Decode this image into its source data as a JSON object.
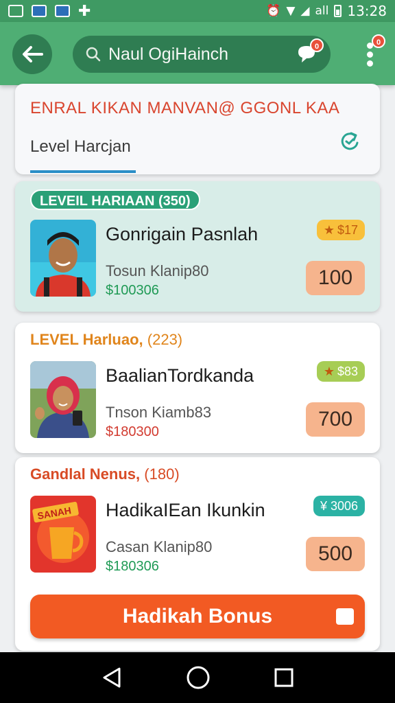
{
  "status_bar": {
    "time": "13:28",
    "signal": "all"
  },
  "app_bar": {
    "search_text": "Naul OgiHainch",
    "chat_badge": "0",
    "menu_badge": "0"
  },
  "header_card": {
    "headline": "ENRAL KIKAN MANVAN@ GGONL KAA",
    "tab_label": "Level Harcjan"
  },
  "rewards": [
    {
      "level_label": "LEVEIL HARIAAN",
      "level_count": "(350)",
      "title": "Gonrigain Pasnlah",
      "subtitle": "Tosun Klanip80",
      "price": "$100306",
      "tag": "$17",
      "points": "100"
    },
    {
      "level_label": "LEVEL Harluao,",
      "level_count": "(223)",
      "title": "BaalianTordkanda",
      "subtitle": "Tnson Kiamb83",
      "price": "$180300",
      "tag": "$83",
      "points": "700"
    },
    {
      "level_label": "Gandlal Nenus,",
      "level_count": "(180)",
      "title": "HadikaIEan Ikunkin",
      "subtitle": "Casan Klanip80",
      "price": "$180306",
      "tag": "¥ 3006",
      "points": "500"
    }
  ],
  "bonus_button": {
    "label": "Hadikah Bonus"
  },
  "promo_image": {
    "text": "SANAH"
  },
  "colors": {
    "primary_green": "#4fae74",
    "accent_orange": "#f25a23",
    "teal": "#2aa077"
  }
}
